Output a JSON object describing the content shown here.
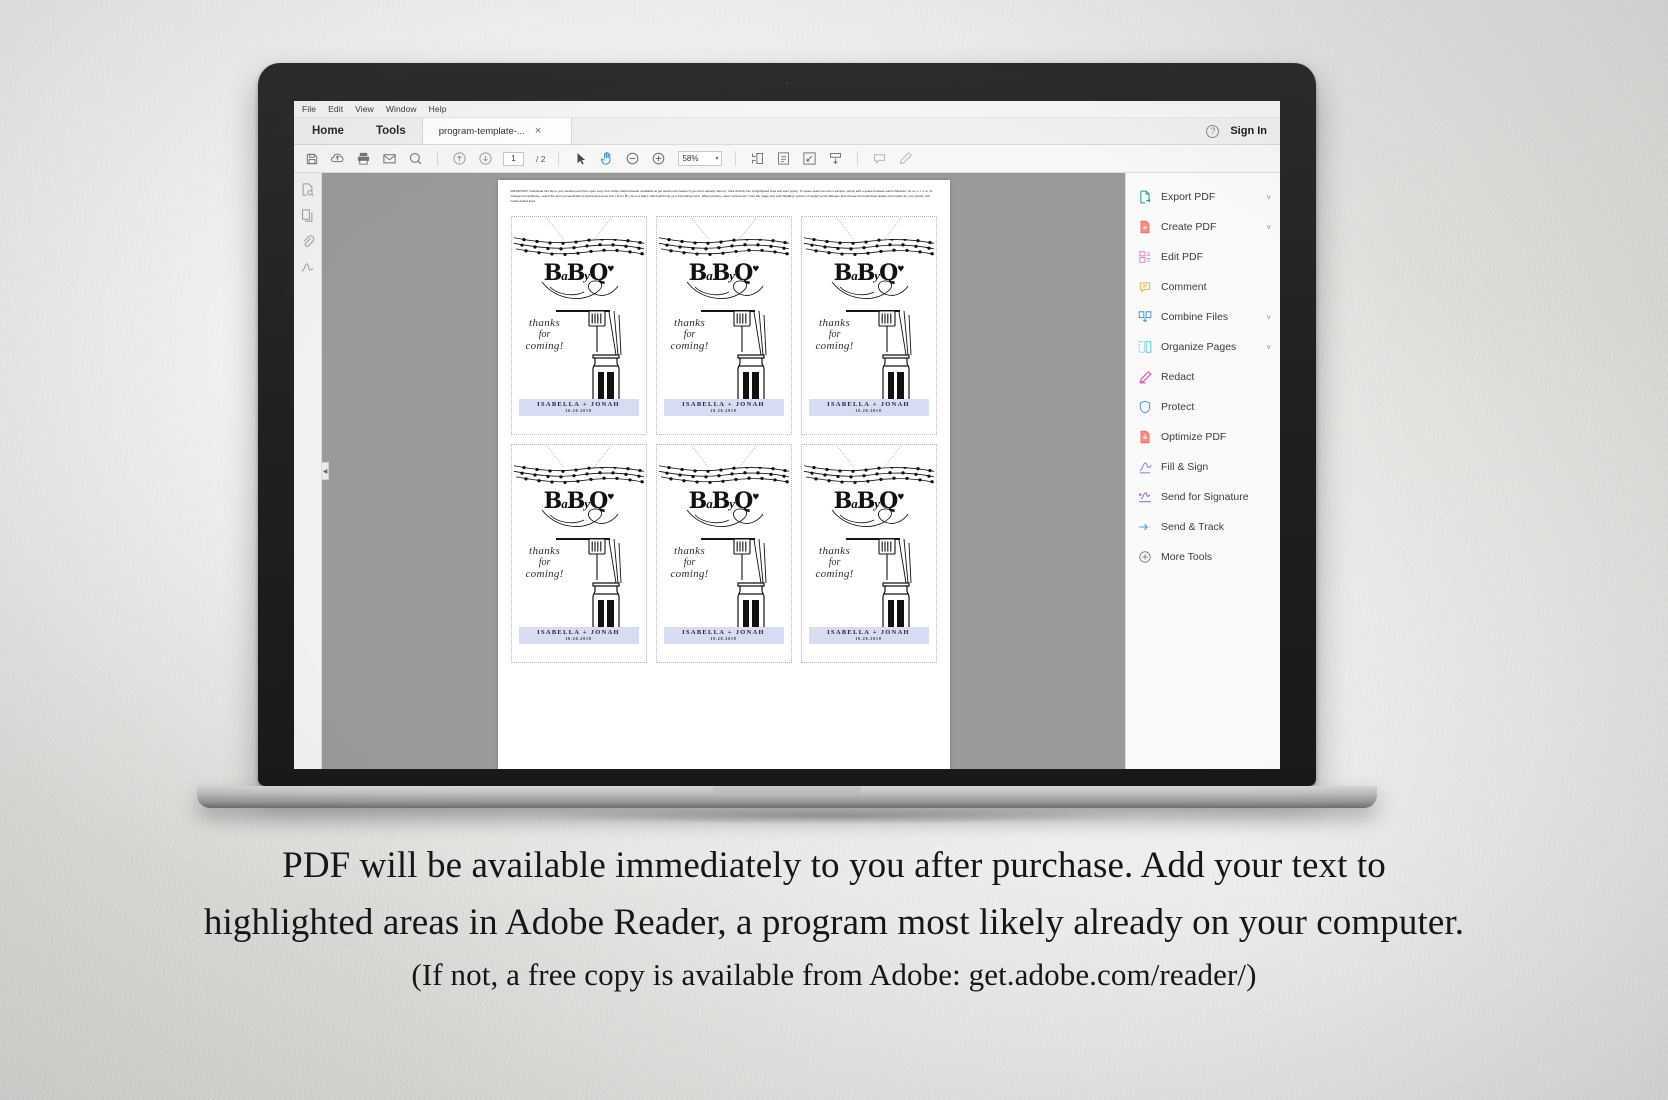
{
  "app": {
    "menubar": [
      "File",
      "Edit",
      "View",
      "Window",
      "Help"
    ],
    "tabs": {
      "home": "Home",
      "tools": "Tools",
      "document": "program-template-...",
      "close_glyph": "×"
    },
    "help_glyph": "?",
    "sign_in": "Sign In",
    "toolbar": {
      "page_current": "1",
      "page_total": "/ 2",
      "zoom_value": "58%",
      "zoom_caret": "▾",
      "icons": [
        "save-icon",
        "upload-to-cloud-icon",
        "print-icon",
        "email-icon",
        "search-icon",
        "previous-page-icon",
        "next-page-icon",
        "select-tool-icon",
        "hand-tool-icon",
        "zoom-out-icon",
        "zoom-in-icon",
        "fit-page-icon",
        "fit-width-icon",
        "fullscreen-icon",
        "scroll-mode-icon",
        "comment-icon",
        "highlight-icon"
      ]
    },
    "left_rail_icons": [
      "page-thumbnails-icon",
      "pages-icon",
      "attachments-icon",
      "signatures-icon"
    ],
    "collapse_arrow": "◀",
    "right_panel": [
      {
        "label": "Export PDF",
        "icon": "export-pdf-icon",
        "chevron": "˅"
      },
      {
        "label": "Create PDF",
        "icon": "create-pdf-icon",
        "chevron": "˅"
      },
      {
        "label": "Edit PDF",
        "icon": "edit-pdf-icon",
        "chevron": ""
      },
      {
        "label": "Comment",
        "icon": "comment-icon",
        "chevron": ""
      },
      {
        "label": "Combine Files",
        "icon": "combine-files-icon",
        "chevron": "˅"
      },
      {
        "label": "Organize Pages",
        "icon": "organize-pages-icon",
        "chevron": "˅"
      },
      {
        "label": "Redact",
        "icon": "redact-icon",
        "chevron": ""
      },
      {
        "label": "Protect",
        "icon": "protect-icon",
        "chevron": ""
      },
      {
        "label": "Optimize PDF",
        "icon": "optimize-pdf-icon",
        "chevron": ""
      },
      {
        "label": "Fill & Sign",
        "icon": "fill-and-sign-icon",
        "chevron": ""
      },
      {
        "label": "Send for Signature",
        "icon": "send-for-signature-icon",
        "chevron": ""
      },
      {
        "label": "Send & Track",
        "icon": "send-and-track-icon",
        "chevron": ""
      },
      {
        "label": "More Tools",
        "icon": "more-tools-icon",
        "chevron": ""
      }
    ]
  },
  "document": {
    "instructions": "IMPORTANT: Download this file to your desktop and then open copy from within Adobe Reader (available at get.adobe.com/reader/ if you don't already have it). Click directly into a highlighted area and start typing. To space select text as in sample, simply add a space between each character; for ex. e r i c a. To change font attributes, select the text you would like to format and press Ctrl + E (or ⌘ + E on a Mac), which will bring up a formatting menu. When printing, select \"actual size\" from the \"page size and handling\" section of reader's print dialogue and choose the better/best quality print option for your printer. Cut inside dotted lines.",
    "tag": {
      "title_b1": "B",
      "title_a": "a",
      "title_b2": "B",
      "title_y": "y",
      "title_q": "Q",
      "title_heart": "♥",
      "thanks_line1": "thanks",
      "thanks_line2": "for",
      "thanks_line3": "coming!",
      "names": "ISABELLA + JONAH",
      "date": "10.20.2018"
    },
    "tag_count": 6
  },
  "caption": {
    "line1": "PDF will be available immediately to you after purchase.  Add your text to",
    "line2": "highlighted areas in Adobe Reader, a program most likely already on your computer.",
    "line3": "(If not, a free copy is available from Adobe: get.adobe.com/reader/)"
  },
  "colors": {
    "highlight_field": "#d6dcf2",
    "canvas_gray": "#9a9a9a",
    "panel_bg": "#fafafa"
  }
}
